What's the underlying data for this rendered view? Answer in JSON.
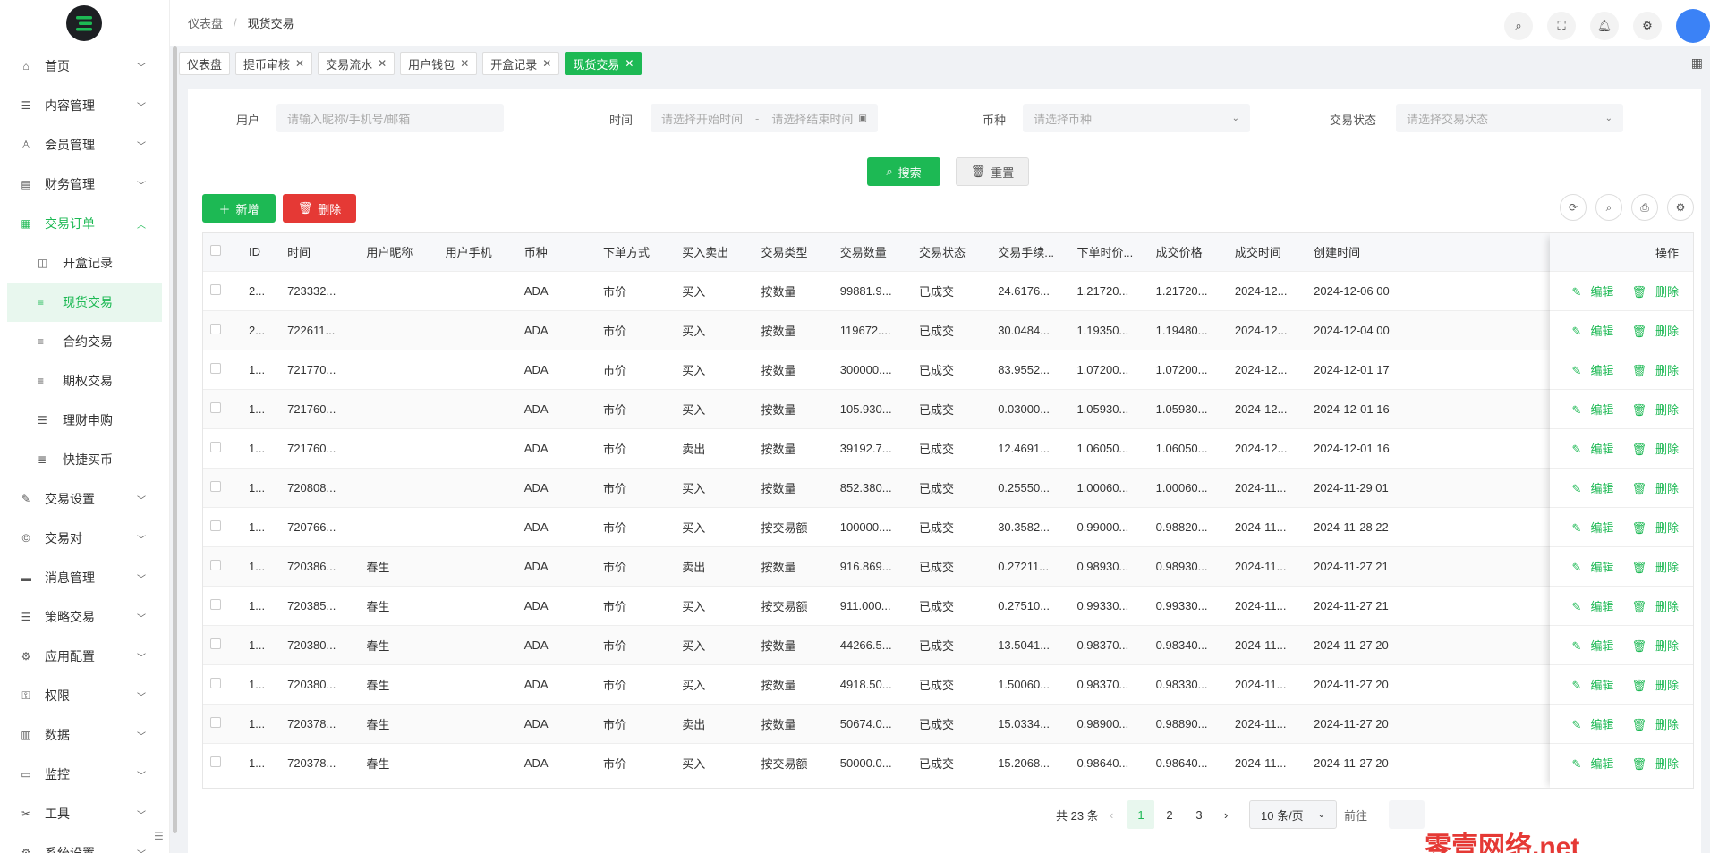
{
  "colors": {
    "accent": "#1db954",
    "danger": "#e53935"
  },
  "sidebar": {
    "items": [
      {
        "label": "首页",
        "icon": "home-icon"
      },
      {
        "label": "内容管理",
        "icon": "list-icon"
      },
      {
        "label": "会员管理",
        "icon": "user-icon"
      },
      {
        "label": "财务管理",
        "icon": "finance-icon"
      },
      {
        "label": "交易订单",
        "icon": "table-icon"
      },
      {
        "label": "交易设置",
        "icon": "wrench-icon"
      },
      {
        "label": "交易对",
        "icon": "coin-icon"
      },
      {
        "label": "消息管理",
        "icon": "message-icon"
      },
      {
        "label": "策略交易",
        "icon": "strategy-icon"
      },
      {
        "label": "应用配置",
        "icon": "config-icon"
      },
      {
        "label": "权限",
        "icon": "permission-icon"
      },
      {
        "label": "数据",
        "icon": "data-icon"
      },
      {
        "label": "监控",
        "icon": "monitor-icon"
      },
      {
        "label": "工具",
        "icon": "tool-icon"
      },
      {
        "label": "系统设置",
        "icon": "settings-icon"
      }
    ],
    "sub": [
      {
        "label": "开盒记录"
      },
      {
        "label": "现货交易"
      },
      {
        "label": "合约交易"
      },
      {
        "label": "期权交易"
      },
      {
        "label": "理财申购"
      },
      {
        "label": "快捷买币"
      }
    ]
  },
  "breadcrumb": {
    "parent": "仪表盘",
    "current": "现货交易"
  },
  "tabs": [
    {
      "label": "仪表盘"
    },
    {
      "label": "提币审核"
    },
    {
      "label": "交易流水"
    },
    {
      "label": "用户钱包"
    },
    {
      "label": "开盒记录"
    },
    {
      "label": "现货交易"
    }
  ],
  "filters": {
    "user_label": "用户",
    "user_placeholder": "请输入昵称/手机号/邮箱",
    "time_label": "时间",
    "time_start": "请选择开始时间",
    "time_sep": "-",
    "time_end": "请选择结束时间",
    "coin_label": "币种",
    "coin_placeholder": "请选择币种",
    "status_label": "交易状态",
    "status_placeholder": "请选择交易状态"
  },
  "buttons": {
    "search": "搜索",
    "reset": "重置",
    "add": "新增",
    "delete": "删除"
  },
  "table": {
    "headers": [
      "ID",
      "时间",
      "用户昵称",
      "用户手机",
      "币种",
      "下单方式",
      "买入卖出",
      "交易类型",
      "交易数量",
      "交易状态",
      "交易手续...",
      "下单时价...",
      "成交价格",
      "成交时间",
      "创建时间"
    ],
    "op_header": "操作",
    "edit": "编辑",
    "remove": "删除",
    "rows": [
      [
        "2...",
        "723332...",
        "",
        "",
        "ADA",
        "市价",
        "买入",
        "按数量",
        "99881.9...",
        "已成交",
        "24.6176...",
        "1.21720...",
        "1.21720...",
        "2024-12...",
        "2024-12-06 00"
      ],
      [
        "2...",
        "722611...",
        "",
        "",
        "ADA",
        "市价",
        "买入",
        "按数量",
        "119672....",
        "已成交",
        "30.0484...",
        "1.19350...",
        "1.19480...",
        "2024-12...",
        "2024-12-04 00"
      ],
      [
        "1...",
        "721770...",
        "",
        "",
        "ADA",
        "市价",
        "买入",
        "按数量",
        "300000....",
        "已成交",
        "83.9552...",
        "1.07200...",
        "1.07200...",
        "2024-12...",
        "2024-12-01 17"
      ],
      [
        "1...",
        "721760...",
        "",
        "",
        "ADA",
        "市价",
        "买入",
        "按数量",
        "105.930...",
        "已成交",
        "0.03000...",
        "1.05930...",
        "1.05930...",
        "2024-12...",
        "2024-12-01 16"
      ],
      [
        "1...",
        "721760...",
        "",
        "",
        "ADA",
        "市价",
        "卖出",
        "按数量",
        "39192.7...",
        "已成交",
        "12.4691...",
        "1.06050...",
        "1.06050...",
        "2024-12...",
        "2024-12-01 16"
      ],
      [
        "1...",
        "720808...",
        "",
        "",
        "ADA",
        "市价",
        "买入",
        "按数量",
        "852.380...",
        "已成交",
        "0.25550...",
        "1.00060...",
        "1.00060...",
        "2024-11...",
        "2024-11-29 01"
      ],
      [
        "1...",
        "720766...",
        "",
        "",
        "ADA",
        "市价",
        "买入",
        "按交易额",
        "100000....",
        "已成交",
        "30.3582...",
        "0.99000...",
        "0.98820...",
        "2024-11...",
        "2024-11-28 22"
      ],
      [
        "1...",
        "720386...",
        "春生",
        "",
        "ADA",
        "市价",
        "卖出",
        "按数量",
        "916.869...",
        "已成交",
        "0.27211...",
        "0.98930...",
        "0.98930...",
        "2024-11...",
        "2024-11-27 21"
      ],
      [
        "1...",
        "720385...",
        "春生",
        "",
        "ADA",
        "市价",
        "买入",
        "按交易额",
        "911.000...",
        "已成交",
        "0.27510...",
        "0.99330...",
        "0.99330...",
        "2024-11...",
        "2024-11-27 21"
      ],
      [
        "1...",
        "720380...",
        "春生",
        "",
        "ADA",
        "市价",
        "买入",
        "按数量",
        "44266.5...",
        "已成交",
        "13.5041...",
        "0.98370...",
        "0.98340...",
        "2024-11...",
        "2024-11-27 20"
      ],
      [
        "1...",
        "720380...",
        "春生",
        "",
        "ADA",
        "市价",
        "买入",
        "按数量",
        "4918.50...",
        "已成交",
        "1.50060...",
        "0.98370...",
        "0.98330...",
        "2024-11...",
        "2024-11-27 20"
      ],
      [
        "1...",
        "720378...",
        "春生",
        "",
        "ADA",
        "市价",
        "卖出",
        "按数量",
        "50674.0...",
        "已成交",
        "15.0334...",
        "0.98900...",
        "0.98890...",
        "2024-11...",
        "2024-11-27 20"
      ],
      [
        "1...",
        "720378...",
        "春生",
        "",
        "ADA",
        "市价",
        "买入",
        "按交易额",
        "50000.0...",
        "已成交",
        "15.2068...",
        "0.98640...",
        "0.98640...",
        "2024-11...",
        "2024-11-27 20"
      ]
    ]
  },
  "pagination": {
    "total": "共 23 条",
    "pages": [
      "1",
      "2",
      "3"
    ],
    "current": "1",
    "page_size": "10 条/页",
    "goto": "前往"
  },
  "watermark": "零壹网络.net"
}
